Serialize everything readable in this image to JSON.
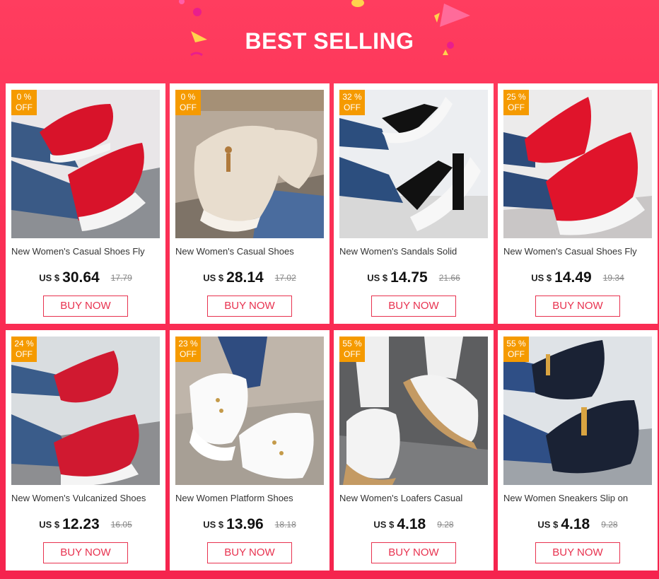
{
  "header": {
    "title": "BEST SELLING"
  },
  "products": [
    {
      "name": "New Women's Casual Shoes Fly",
      "discount": "0 %",
      "off": "OFF",
      "currency": "US $",
      "price": "30.64",
      "old_price": "17.79",
      "cta": "BUY NOW",
      "colors": {
        "bg": "#e9e6e8",
        "floor": "#8c8f94",
        "shoe": "#d8132a",
        "sole": "#f4f4f4",
        "leg": "#3a5a86"
      }
    },
    {
      "name": "New Women's Casual Shoes",
      "discount": "0 %",
      "off": "OFF",
      "currency": "US $",
      "price": "28.14",
      "old_price": "17.02",
      "cta": "BUY NOW",
      "colors": {
        "bg": "#b7a99a",
        "floor": "#7e7367",
        "shoe": "#e8ddce",
        "sole": "#f6f1ea",
        "leg": "#4a6c9e"
      }
    },
    {
      "name": "New Women's Sandals Solid",
      "discount": "32 %",
      "off": "OFF",
      "currency": "US $",
      "price": "14.75",
      "old_price": "21.66",
      "cta": "BUY NOW",
      "colors": {
        "bg": "#eceef1",
        "floor": "#d8d8d8",
        "shoe": "#111111",
        "sole": "#f7f7f7",
        "leg": "#2c4e7e"
      }
    },
    {
      "name": "New Women's Casual Shoes Fly",
      "discount": "25 %",
      "off": "OFF",
      "currency": "US $",
      "price": "14.49",
      "old_price": "19.34",
      "cta": "BUY NOW",
      "colors": {
        "bg": "#ecebeb",
        "floor": "#c9c6c6",
        "shoe": "#e0142b",
        "sole": "#f5f5f5",
        "leg": "#2d4b7a"
      }
    },
    {
      "name": "New Women's Vulcanized Shoes",
      "discount": "24 %",
      "off": "OFF",
      "currency": "US $",
      "price": "12.23",
      "old_price": "16.05",
      "cta": "BUY NOW",
      "colors": {
        "bg": "#d9dde0",
        "floor": "#8d8e91",
        "shoe": "#d01930",
        "sole": "#f4f4f4",
        "leg": "#3a5c8a"
      }
    },
    {
      "name": "New Women Platform Shoes",
      "discount": "23 %",
      "off": "OFF",
      "currency": "US $",
      "price": "13.96",
      "old_price": "18.18",
      "cta": "BUY NOW",
      "colors": {
        "bg": "#bfb5aa",
        "floor": "#a79f95",
        "shoe": "#fafafa",
        "sole": "#ffffff",
        "leg": "#2f4c80"
      }
    },
    {
      "name": "New Women's Loafers Casual",
      "discount": "55 %",
      "off": "OFF",
      "currency": "US $",
      "price": "4.18",
      "old_price": "9.28",
      "cta": "BUY NOW",
      "colors": {
        "bg": "#5d5e60",
        "floor": "#7b7c7e",
        "shoe": "#f3f3f3",
        "sole": "#c49a63",
        "leg": "#efefef"
      }
    },
    {
      "name": "New Women Sneakers Slip on",
      "discount": "55 %",
      "off": "OFF",
      "currency": "US $",
      "price": "4.18",
      "old_price": "9.28",
      "cta": "BUY NOW",
      "colors": {
        "bg": "#dfe3e7",
        "floor": "#9ea3a9",
        "shoe": "#1a2234",
        "sole": "#20273a",
        "leg": "#2f4f86"
      }
    }
  ]
}
